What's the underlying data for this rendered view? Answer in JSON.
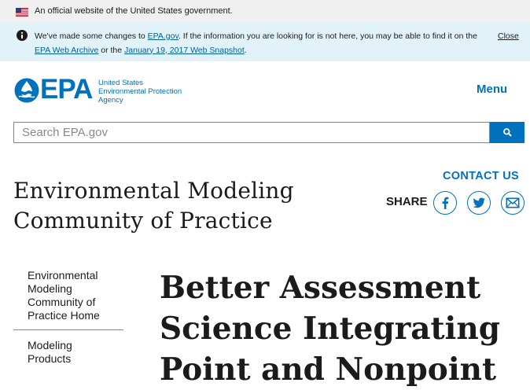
{
  "gov_banner": {
    "text": "An official website of the United States government."
  },
  "notice": {
    "part1": "We've made some changes to ",
    "link1": "EPA.gov",
    "part2": ". If the information you are looking for is not here, you may be able to find it on the ",
    "link2": "EPA Web Archive",
    "part3": " or the ",
    "link3": "January 19, 2017 Web Snapshot",
    "part4": ".",
    "close_label": "Close"
  },
  "header": {
    "logo_letters": "EPA",
    "agency_line1": "United States",
    "agency_line2": "Environmental Protection",
    "agency_line3": "Agency",
    "menu_label": "Menu"
  },
  "search": {
    "placeholder": "Search EPA.gov",
    "value": ""
  },
  "page": {
    "title_line1": "Environmental Modeling",
    "title_line2": "Community of Practice",
    "contact_label": "CONTACT US",
    "share_label": "SHARE"
  },
  "share_icons": [
    "facebook-icon",
    "twitter-icon",
    "email-icon"
  ],
  "sidenav": {
    "items": [
      {
        "label": "Environmental Modeling Community of Practice Home"
      },
      {
        "label": "Modeling Products"
      }
    ]
  },
  "content": {
    "heading_line1": "Better Assessment",
    "heading_line2": "Science Integrating",
    "heading_line3": "Point and Nonpoint"
  },
  "colors": {
    "brand_blue": "#0071bc",
    "notice_bg": "#e1f3f8",
    "banner_bg": "#f0f0f0"
  }
}
